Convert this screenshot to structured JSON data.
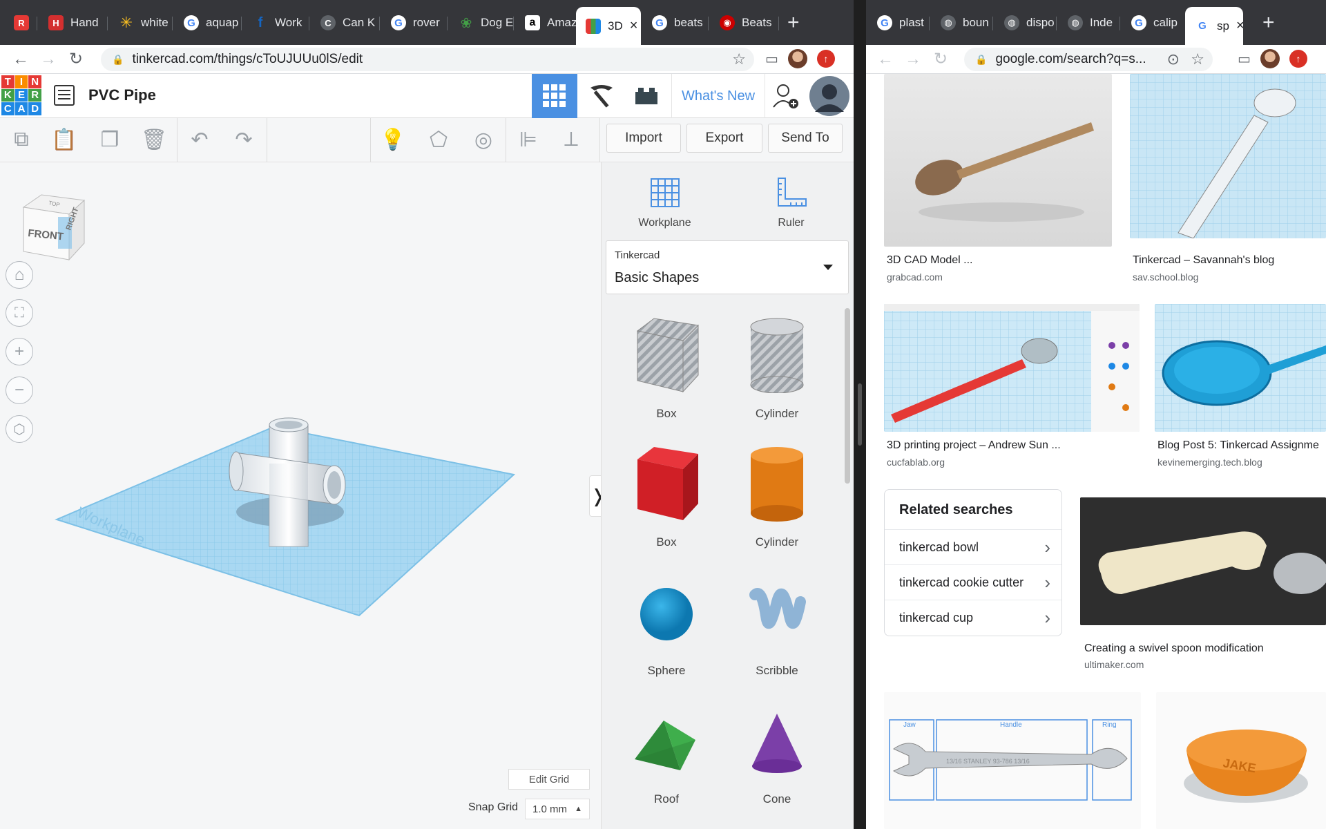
{
  "left_browser": {
    "tabs": [
      {
        "label": "",
        "icon": "r-icon",
        "color": "#e53935"
      },
      {
        "label": "Hand",
        "icon": "h-icon",
        "color": "#d32f2f"
      },
      {
        "label": "white",
        "icon": "walmart-icon",
        "color": "#ffc220"
      },
      {
        "label": "aquap",
        "icon": "google-icon",
        "color": "#4285f4"
      },
      {
        "label": "Work",
        "icon": "f-icon",
        "color": "#1565c0"
      },
      {
        "label": "Can K",
        "icon": "c-icon",
        "color": "#9e9e9e"
      },
      {
        "label": "rover",
        "icon": "google-icon",
        "color": "#4285f4"
      },
      {
        "label": "Dog E",
        "icon": "paw-icon",
        "color": "#43a047"
      },
      {
        "label": "Amaz",
        "icon": "amazon-icon",
        "color": "#000000"
      },
      {
        "label": "3D",
        "icon": "tinkercad-icon",
        "color": "#4285f4",
        "active": true
      },
      {
        "label": "beats",
        "icon": "google-icon",
        "color": "#4285f4"
      },
      {
        "label": "Beats",
        "icon": "target-icon",
        "color": "#cc0000"
      }
    ],
    "url": "tinkercad.com/things/cToUJUUu0lS/edit"
  },
  "tinkercad": {
    "logo_letters": [
      "T",
      "I",
      "N",
      "K",
      "E",
      "R",
      "C",
      "A",
      "D"
    ],
    "design_title": "PVC Pipe",
    "whats_new": "What's New",
    "import": "Import",
    "export": "Export",
    "send_to": "Send To",
    "viewcube": {
      "front": "FRONT",
      "right": "RIGHT",
      "top": "TOP"
    },
    "workplane_btn": "Workplane",
    "ruler_btn": "Ruler",
    "library": {
      "caption": "Tinkercad",
      "value": "Basic Shapes"
    },
    "shapes": [
      {
        "label": "Box",
        "icon": "box-hole-icon"
      },
      {
        "label": "Cylinder",
        "icon": "cylinder-hole-icon"
      },
      {
        "label": "Box",
        "icon": "box-icon"
      },
      {
        "label": "Cylinder",
        "icon": "cylinder-icon"
      },
      {
        "label": "Sphere",
        "icon": "sphere-icon"
      },
      {
        "label": "Scribble",
        "icon": "scribble-icon"
      },
      {
        "label": "Roof",
        "icon": "roof-icon"
      },
      {
        "label": "Cone",
        "icon": "cone-icon"
      }
    ],
    "edit_grid": "Edit Grid",
    "snap_grid_label": "Snap Grid",
    "snap_grid_value": "1.0 mm",
    "workplane_watermark": "Workplane"
  },
  "right_browser": {
    "tabs": [
      {
        "label": "plast",
        "icon": "google-icon"
      },
      {
        "label": "boun",
        "icon": "globe-icon"
      },
      {
        "label": "dispo",
        "icon": "globe-icon"
      },
      {
        "label": "Inde",
        "icon": "globe-icon"
      },
      {
        "label": "calip",
        "icon": "google-icon"
      },
      {
        "label": "sp",
        "icon": "google-icon",
        "active": true
      }
    ],
    "url": "google.com/search?q=s..."
  },
  "google": {
    "results": [
      {
        "caption": "3D CAD Model ...",
        "source": "grabcad.com"
      },
      {
        "caption": "Tinkercad – Savannah's blog",
        "source": "sav.school.blog"
      },
      {
        "caption": "3D printing project – Andrew Sun ...",
        "source": "cucfablab.org"
      },
      {
        "caption": "Blog Post 5: Tinkercad Assignme",
        "source": "kevinemerging.tech.blog"
      },
      {
        "caption": "Creating a swivel spoon modification",
        "source": "ultimaker.com"
      }
    ],
    "related_title": "Related searches",
    "related": [
      "tinkercad bowl",
      "tinkercad cookie cutter",
      "tinkercad cup"
    ],
    "wrench_labels": {
      "jaw": "Jaw",
      "handle": "Handle",
      "ring": "Ring",
      "engraving": "13/16   STANLEY 93-786   13/16"
    },
    "bowl_text": "JAKE"
  }
}
